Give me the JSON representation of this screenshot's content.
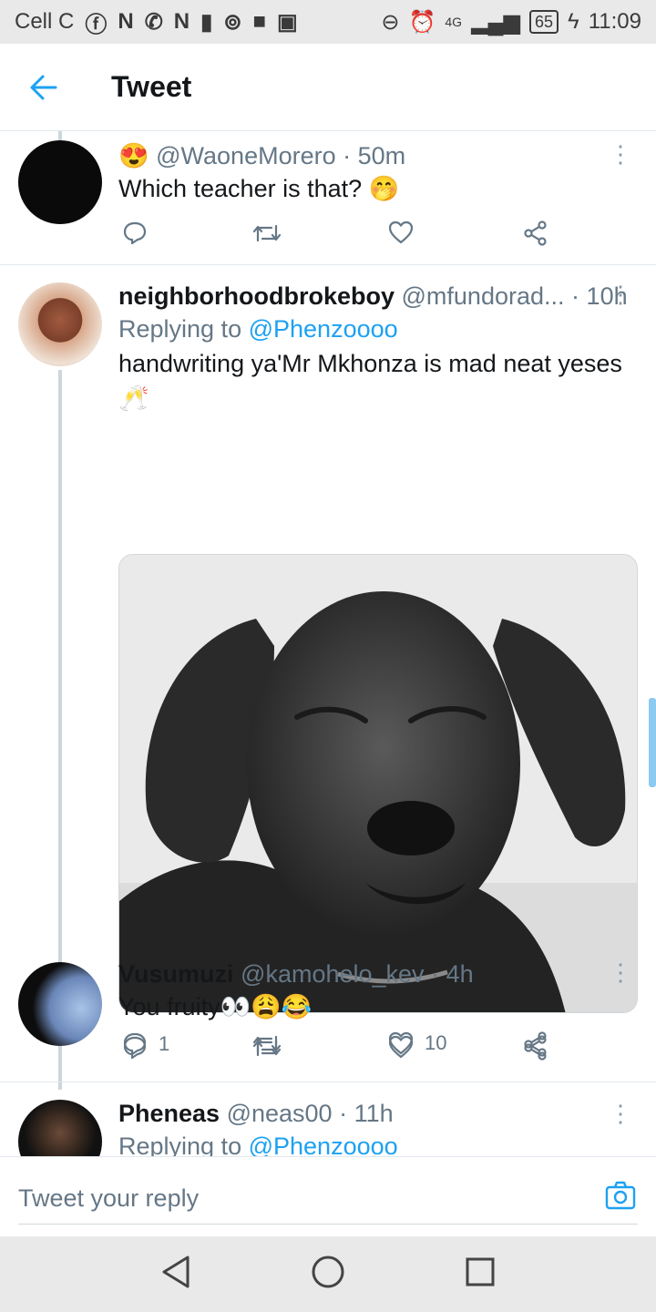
{
  "status_bar": {
    "carrier": "Cell C",
    "network": "4G",
    "battery": "65",
    "time": "11:09"
  },
  "app_bar": {
    "title": "Tweet"
  },
  "tweets": [
    {
      "handle": "@WaoneMorero",
      "separator": "·",
      "time": "50m",
      "text": "Which teacher is that? 🤭",
      "avatar_color": "#0a0a0a"
    },
    {
      "name": "neighborhoodbrokeboy",
      "handle": "@mfundorad...",
      "separator": "·",
      "time": "10h",
      "replying_label": "Replying to",
      "replying_to": "@Phenzoooo",
      "text": "handwriting ya'Mr Mkhonza is mad neat yeses 🥂",
      "reply_count": "1",
      "like_count": "10"
    },
    {
      "name": "Vusumuzi",
      "handle": "@kamohelo_kev",
      "separator": "·",
      "time": "4h",
      "text": "You fruity👀😩😂"
    },
    {
      "name": "Pheneas",
      "handle": "@neas00",
      "separator": "·",
      "time": "11h",
      "replying_label": "Replying to",
      "replying_to": "@Phenzoooo"
    }
  ],
  "reply_bar": {
    "placeholder": "Tweet your reply"
  },
  "icons": {
    "back": "arrow-left-icon",
    "reply": "comment-icon",
    "retweet": "retweet-icon",
    "like": "heart-icon",
    "share": "share-icon",
    "more": "more-vertical-icon",
    "camera": "camera-icon"
  },
  "colors": {
    "accent": "#1da1f2",
    "muted": "#657786",
    "text": "#14171a"
  }
}
